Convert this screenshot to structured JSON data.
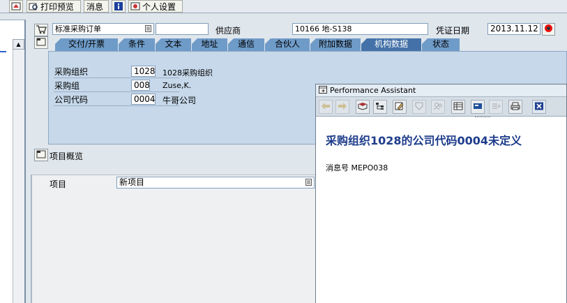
{
  "toolbar": {
    "print_preview": "打印预览",
    "messages": "消息",
    "personal_settings": "个人设置"
  },
  "header": {
    "doc_type": "标准采购订单",
    "vendor_label": "供应商",
    "vendor_value": "10166 地-S138",
    "doc_date_label": "凭证日期",
    "doc_date_value": "2013.11.12"
  },
  "tabs": [
    {
      "label": "交付/开票"
    },
    {
      "label": "条件"
    },
    {
      "label": "文本"
    },
    {
      "label": "地址"
    },
    {
      "label": "通信"
    },
    {
      "label": "合伙人"
    },
    {
      "label": "附加数据"
    },
    {
      "label": "机构数据",
      "active": true
    },
    {
      "label": "状态"
    }
  ],
  "org_data": {
    "purch_org_label": "采购组织",
    "purch_org_code": "1028",
    "purch_org_name": "1028采购组织",
    "purch_group_label": "采购组",
    "purch_group_code": "008",
    "purch_group_name": "Zuse,K.",
    "company_code_label": "公司代码",
    "company_code_code": "0004",
    "company_code_name": "牛哥公司"
  },
  "items_overview": {
    "label": "项目概览"
  },
  "item_row": {
    "label": "项目",
    "value": "新项目"
  },
  "performance_assistant": {
    "title": "Performance Assistant",
    "message": "采购组织1028的公司代码0004未定义",
    "message_no": "消息号  MEPO038"
  },
  "colors": {
    "tab": "#6f9bc8",
    "tab_active": "#4472a8",
    "content_bg": "#c6d8ea",
    "message_text": "#1e3c8c"
  }
}
